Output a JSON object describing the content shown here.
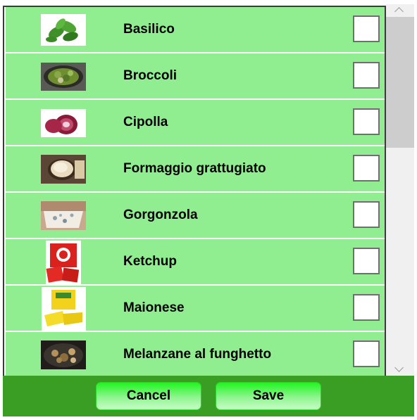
{
  "items": [
    {
      "label": "Basilico",
      "image": "basil-leaves"
    },
    {
      "label": "Broccoli",
      "image": "broccoli-pan"
    },
    {
      "label": "Cipolla",
      "image": "red-onion"
    },
    {
      "label": "Formaggio grattugiato",
      "image": "grated-cheese"
    },
    {
      "label": "Gorgonzola",
      "image": "gorgonzola-cheese"
    },
    {
      "label": "Ketchup",
      "image": "ketchup-packets"
    },
    {
      "label": "Maionese",
      "image": "mayonnaise-packets"
    },
    {
      "label": "Melanzane al funghetto",
      "image": "eggplant-mushrooms"
    }
  ],
  "footer": {
    "cancel_label": "Cancel",
    "save_label": "Save"
  },
  "colors": {
    "row_background": "#90ee90",
    "footer_background": "#3a9e24",
    "button_gradient_top": "#1ff51f"
  }
}
